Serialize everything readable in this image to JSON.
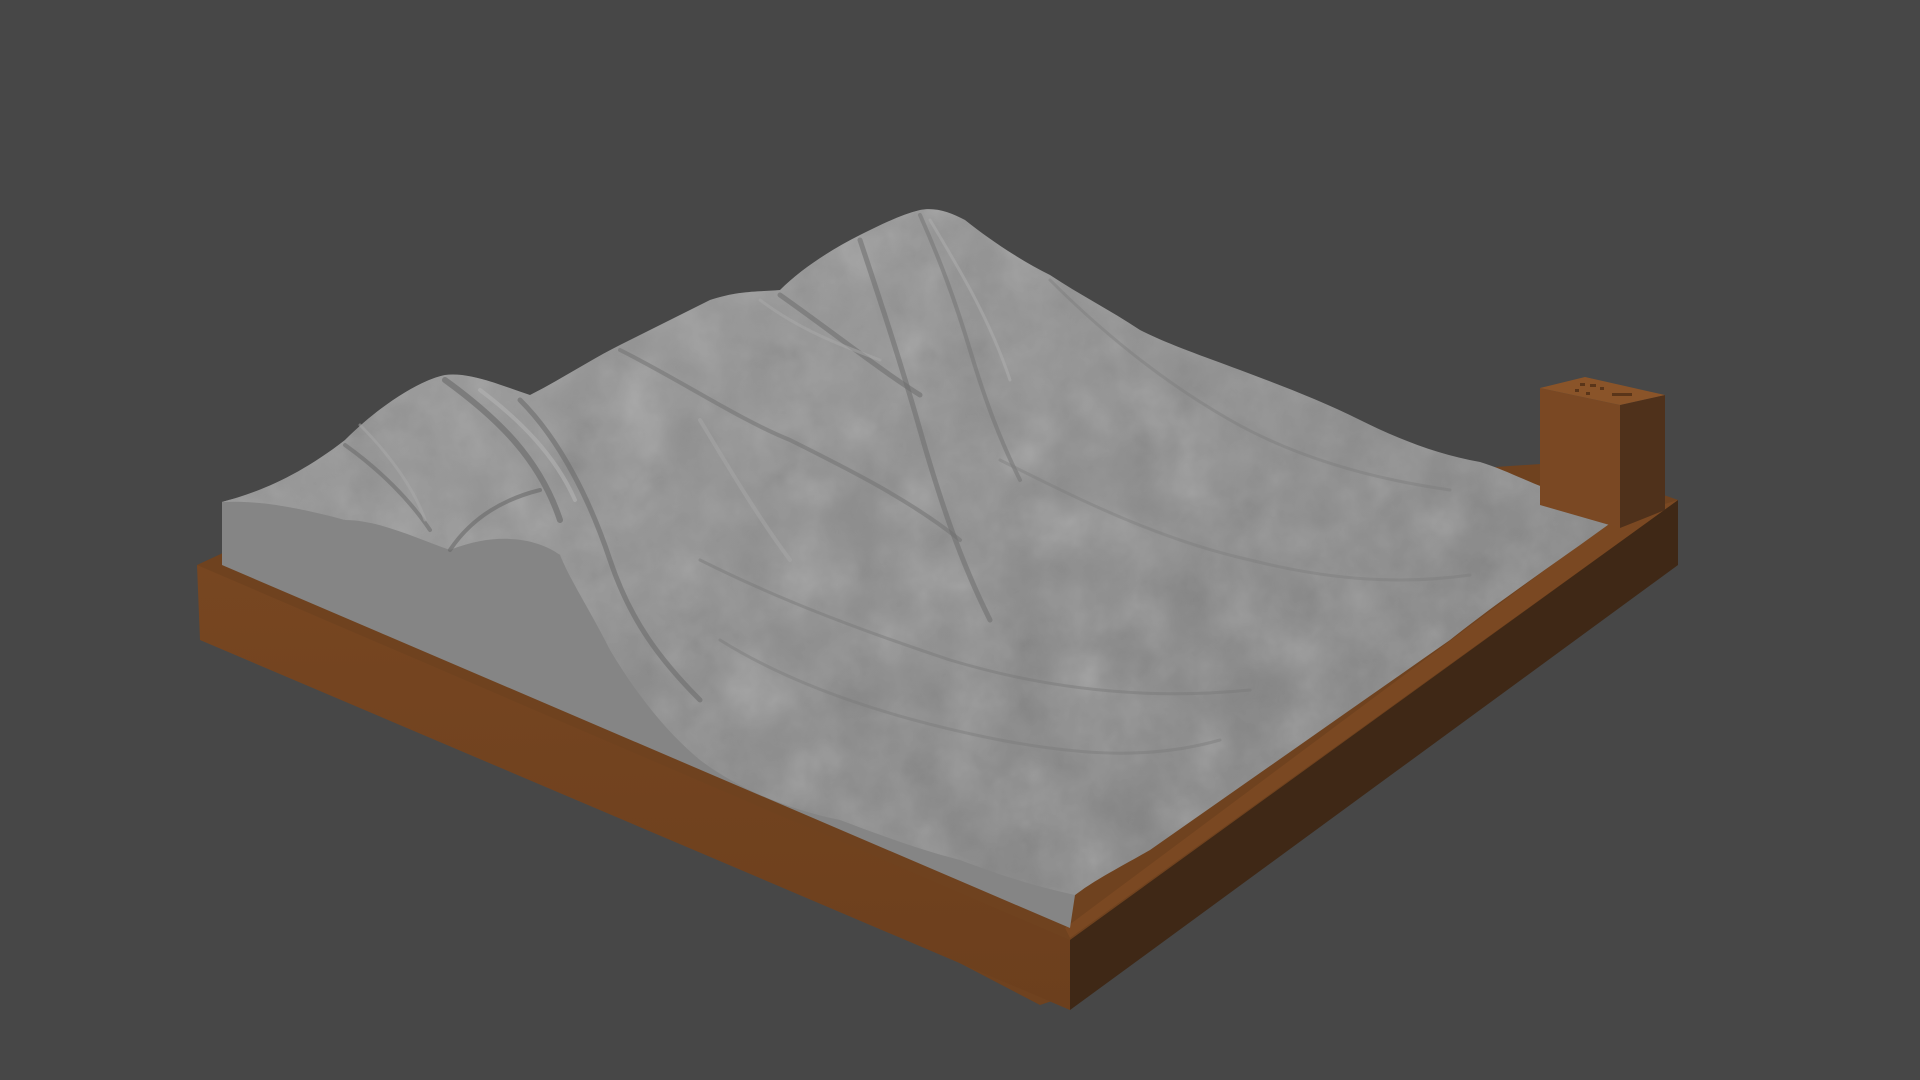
{
  "scene": {
    "background_color": "#474747",
    "base_color": "#73441f",
    "terrain_color": "#8a8a8a",
    "terrain_side_color": "#858585",
    "objects": [
      "terrain-model",
      "wooden-base",
      "label-block"
    ]
  }
}
